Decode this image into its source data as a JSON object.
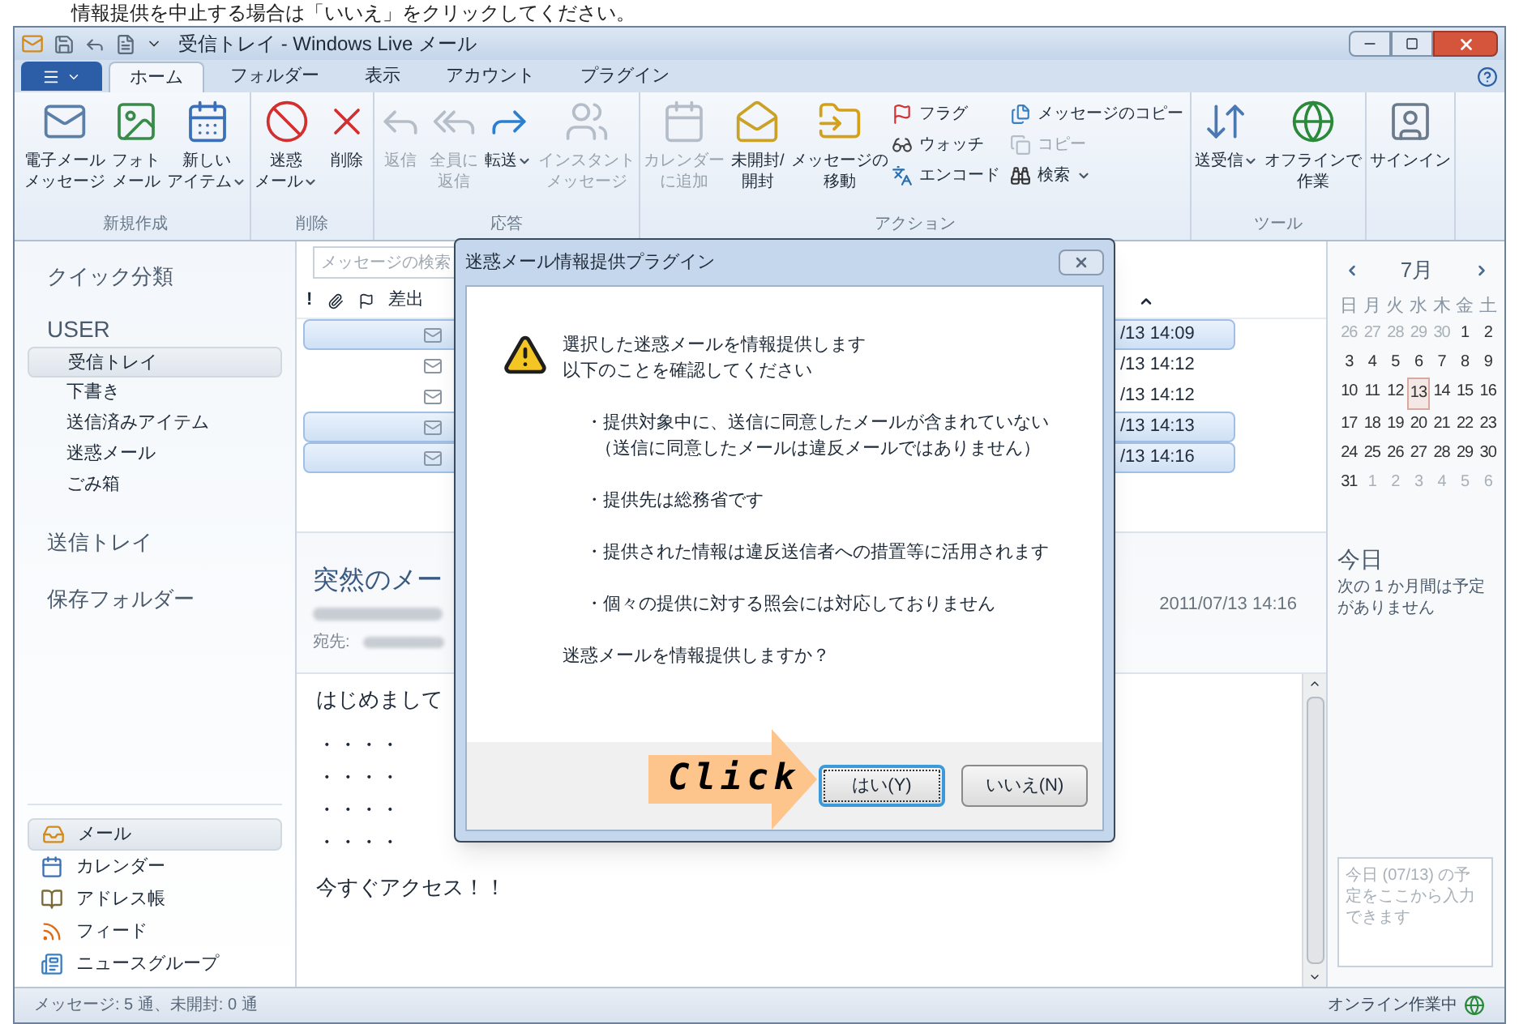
{
  "caption": "情報提供を中止する場合は「いいえ」をクリックしてください。",
  "window": {
    "title": "受信トレイ - Windows Live メール"
  },
  "tabs": [
    {
      "label": "ホーム",
      "selected": true
    },
    {
      "label": "フォルダー",
      "selected": false
    },
    {
      "label": "表示",
      "selected": false
    },
    {
      "label": "アカウント",
      "selected": false
    },
    {
      "label": "プラグイン",
      "selected": false
    }
  ],
  "ribbon": {
    "groups": [
      {
        "label": "新規作成",
        "buttons": [
          {
            "lines": [
              "電子メール",
              "メッセージ"
            ],
            "dropdown": false,
            "disabled": false
          },
          {
            "lines": [
              "フォト",
              "メール"
            ],
            "dropdown": false,
            "disabled": false
          },
          {
            "lines": [
              "新しい",
              "アイテム"
            ],
            "dropdown": true,
            "disabled": false
          }
        ]
      },
      {
        "label": "削除",
        "buttons": [
          {
            "lines": [
              "迷惑",
              "メール"
            ],
            "dropdown": true,
            "disabled": false
          },
          {
            "lines": [
              "削除"
            ],
            "dropdown": false,
            "disabled": false
          }
        ]
      },
      {
        "label": "応答",
        "buttons": [
          {
            "lines": [
              "返信"
            ],
            "dropdown": false,
            "disabled": true
          },
          {
            "lines": [
              "全員に",
              "返信"
            ],
            "dropdown": false,
            "disabled": true
          },
          {
            "lines": [
              "転送"
            ],
            "dropdown": true,
            "disabled": false
          },
          {
            "lines": [
              "インスタント",
              "メッセージ"
            ],
            "dropdown": false,
            "disabled": true
          }
        ]
      },
      {
        "label": "アクション",
        "buttons": [
          {
            "lines": [
              "カレンダー",
              "に追加"
            ],
            "dropdown": false,
            "disabled": true
          },
          {
            "lines": [
              "未開封/",
              "開封"
            ],
            "dropdown": false,
            "disabled": false
          },
          {
            "lines": [
              "メッセージの",
              "移動"
            ],
            "dropdown": false,
            "disabled": false
          }
        ],
        "small_buttons": [
          {
            "label": "フラグ",
            "dropdown": false,
            "disabled": false
          },
          {
            "label": "ウォッチ",
            "dropdown": false,
            "disabled": false
          },
          {
            "label": "エンコード",
            "dropdown": false,
            "disabled": false
          },
          {
            "label": "メッセージのコピー",
            "dropdown": false,
            "disabled": false
          },
          {
            "label": "コピー",
            "dropdown": false,
            "disabled": true
          },
          {
            "label": "検索",
            "dropdown": true,
            "disabled": false
          }
        ]
      },
      {
        "label": "ツール",
        "buttons": [
          {
            "lines": [
              "送受信"
            ],
            "dropdown": true,
            "disabled": false
          },
          {
            "lines": [
              "オフラインで",
              "作業"
            ],
            "dropdown": false,
            "disabled": false
          }
        ]
      },
      {
        "buttons": [
          {
            "lines": [
              "サインイン"
            ],
            "dropdown": false,
            "disabled": false
          }
        ]
      }
    ]
  },
  "sidebar": {
    "quick_views": "クイック分類",
    "account": "USER",
    "folders": [
      {
        "label": "受信トレイ",
        "selected": true
      },
      {
        "label": "下書き",
        "selected": false
      },
      {
        "label": "送信済みアイテム",
        "selected": false
      },
      {
        "label": "迷惑メール",
        "selected": false
      },
      {
        "label": "ごみ箱",
        "selected": false
      }
    ],
    "sections": [
      "送信トレイ",
      "保存フォルダー"
    ],
    "nav": [
      {
        "label": "メール",
        "selected": true
      },
      {
        "label": "カレンダー",
        "selected": false
      },
      {
        "label": "アドレス帳",
        "selected": false
      },
      {
        "label": "フィード",
        "selected": false
      },
      {
        "label": "ニュースグループ",
        "selected": false
      }
    ]
  },
  "message_list": {
    "search": {
      "placeholder": "メッセージの検索"
    },
    "column_1": "!",
    "column_4": "差出",
    "rows": [
      {
        "date": "/13 14:09",
        "selected": true
      },
      {
        "date": "/13 14:12",
        "selected": false
      },
      {
        "date": "/13 14:12",
        "selected": false
      },
      {
        "date": "/13 14:13",
        "selected": true
      },
      {
        "date": "/13 14:16",
        "selected": true
      }
    ]
  },
  "reading_pane": {
    "subject": "突然のメー",
    "to_label": "宛先:",
    "date": "2011/07/13 14:16",
    "body": [
      "はじめまして",
      "・・・・",
      "・・・・",
      "・・・・",
      "・・・・",
      "今すぐアクセス！！"
    ]
  },
  "calendar": {
    "month": "7月",
    "weekdays": [
      "日",
      "月",
      "火",
      "水",
      "木",
      "金",
      "土"
    ],
    "weeks": [
      [
        {
          "d": "26",
          "other": true,
          "selected": false
        },
        {
          "d": "27",
          "other": true,
          "selected": false
        },
        {
          "d": "28",
          "other": true,
          "selected": false
        },
        {
          "d": "29",
          "other": true,
          "selected": false
        },
        {
          "d": "30",
          "other": true,
          "selected": false
        },
        {
          "d": "1",
          "other": false,
          "selected": false
        },
        {
          "d": "2",
          "other": false,
          "selected": false
        }
      ],
      [
        {
          "d": "3",
          "other": false,
          "selected": false
        },
        {
          "d": "4",
          "other": false,
          "selected": false
        },
        {
          "d": "5",
          "other": false,
          "selected": false
        },
        {
          "d": "6",
          "other": false,
          "selected": false
        },
        {
          "d": "7",
          "other": false,
          "selected": false
        },
        {
          "d": "8",
          "other": false,
          "selected": false
        },
        {
          "d": "9",
          "other": false,
          "selected": false
        }
      ],
      [
        {
          "d": "10",
          "other": false,
          "selected": false
        },
        {
          "d": "11",
          "other": false,
          "selected": false
        },
        {
          "d": "12",
          "other": false,
          "selected": false
        },
        {
          "d": "13",
          "other": false,
          "selected": true
        },
        {
          "d": "14",
          "other": false,
          "selected": false
        },
        {
          "d": "15",
          "other": false,
          "selected": false
        },
        {
          "d": "16",
          "other": false,
          "selected": false
        }
      ],
      [
        {
          "d": "17",
          "other": false,
          "selected": false
        },
        {
          "d": "18",
          "other": false,
          "selected": false
        },
        {
          "d": "19",
          "other": false,
          "selected": false
        },
        {
          "d": "20",
          "other": false,
          "selected": false
        },
        {
          "d": "21",
          "other": false,
          "selected": false
        },
        {
          "d": "22",
          "other": false,
          "selected": false
        },
        {
          "d": "23",
          "other": false,
          "selected": false
        }
      ],
      [
        {
          "d": "24",
          "other": false,
          "selected": false
        },
        {
          "d": "25",
          "other": false,
          "selected": false
        },
        {
          "d": "26",
          "other": false,
          "selected": false
        },
        {
          "d": "27",
          "other": false,
          "selected": false
        },
        {
          "d": "28",
          "other": false,
          "selected": false
        },
        {
          "d": "29",
          "other": false,
          "selected": false
        },
        {
          "d": "30",
          "other": false,
          "selected": false
        }
      ],
      [
        {
          "d": "31",
          "other": false,
          "selected": false
        },
        {
          "d": "1",
          "other": true,
          "selected": false
        },
        {
          "d": "2",
          "other": true,
          "selected": false
        },
        {
          "d": "3",
          "other": true,
          "selected": false
        },
        {
          "d": "4",
          "other": true,
          "selected": false
        },
        {
          "d": "5",
          "other": true,
          "selected": false
        },
        {
          "d": "6",
          "other": true,
          "selected": false
        }
      ]
    ],
    "today_heading": "今日",
    "today_text": "次の 1 か月間は予定がありません",
    "note": {
      "placeholder": "今日 (07/13) の予定をここから入力できます"
    }
  },
  "status_bar": {
    "left": "メッセージ: 5 通、未開封: 0 通",
    "right": "オンライン作業中"
  },
  "dialog": {
    "title": "迷惑メール情報提供プラグイン",
    "intro": [
      "選択した迷惑メールを情報提供します",
      "以下のことを確認してください"
    ],
    "bullets": [
      {
        "text": "・提供対象中に、送信に同意したメールが含まれていない",
        "note": "（送信に同意したメールは違反メールではありません）"
      },
      {
        "text": "・提供先は総務省です"
      },
      {
        "text": "・提供された情報は違反送信者への措置等に活用されます"
      },
      {
        "text": "・個々の提供に対する照会には対応しておりません"
      }
    ],
    "question": "迷惑メールを情報提供しますか？",
    "buttons": [
      {
        "label": "はい(Y)",
        "focused": true
      },
      {
        "label": "いいえ(N)",
        "focused": false
      }
    ]
  },
  "callout": {
    "label": "Click"
  }
}
